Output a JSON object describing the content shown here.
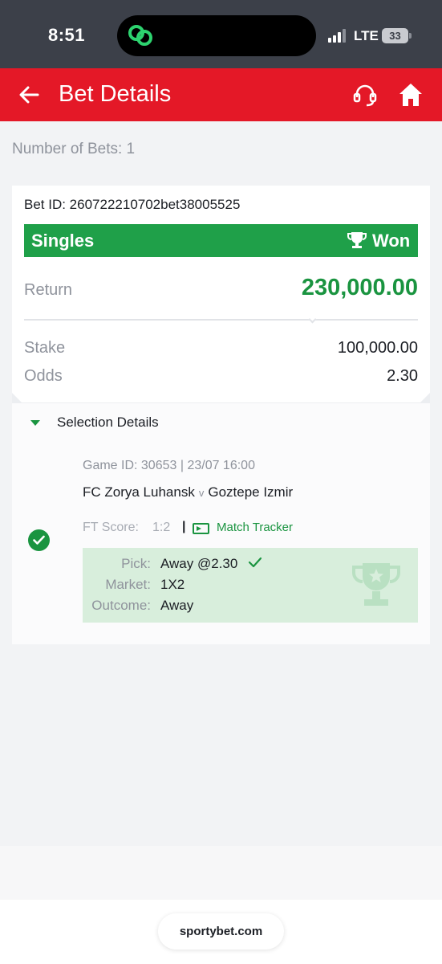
{
  "status_bar": {
    "time": "8:51",
    "network": "LTE",
    "battery": "33"
  },
  "header": {
    "title": "Bet Details"
  },
  "summary": {
    "bets_count": "Number of Bets: 1"
  },
  "bet": {
    "id": "Bet ID: 260722210702bet38005525",
    "type": "Singles",
    "status": "Won",
    "return_label": "Return",
    "return_value": "230,000.00",
    "stake_label": "Stake",
    "stake_value": "100,000.00",
    "odds_label": "Odds",
    "odds_value": "2.30"
  },
  "selection": {
    "section_title": "Selection Details",
    "game_id": "Game ID: 30653 | 23/07 16:00",
    "home_team": "FC Zorya Luhansk",
    "vs": "v",
    "away_team": "Goztepe Izmir",
    "score_label": "FT Score:",
    "score_value": "1:2",
    "separator": "|",
    "tracker_label": "Match Tracker",
    "pick_label": "Pick:",
    "pick_value": "Away @2.30",
    "market_label": "Market:",
    "market_value": "1X2",
    "outcome_label": "Outcome:",
    "outcome_value": "Away"
  },
  "footer": {
    "url": "sportybet.com"
  },
  "colors": {
    "brand_red": "#e41827",
    "win_green": "#1fa049",
    "pick_bg": "#d8eedc"
  }
}
